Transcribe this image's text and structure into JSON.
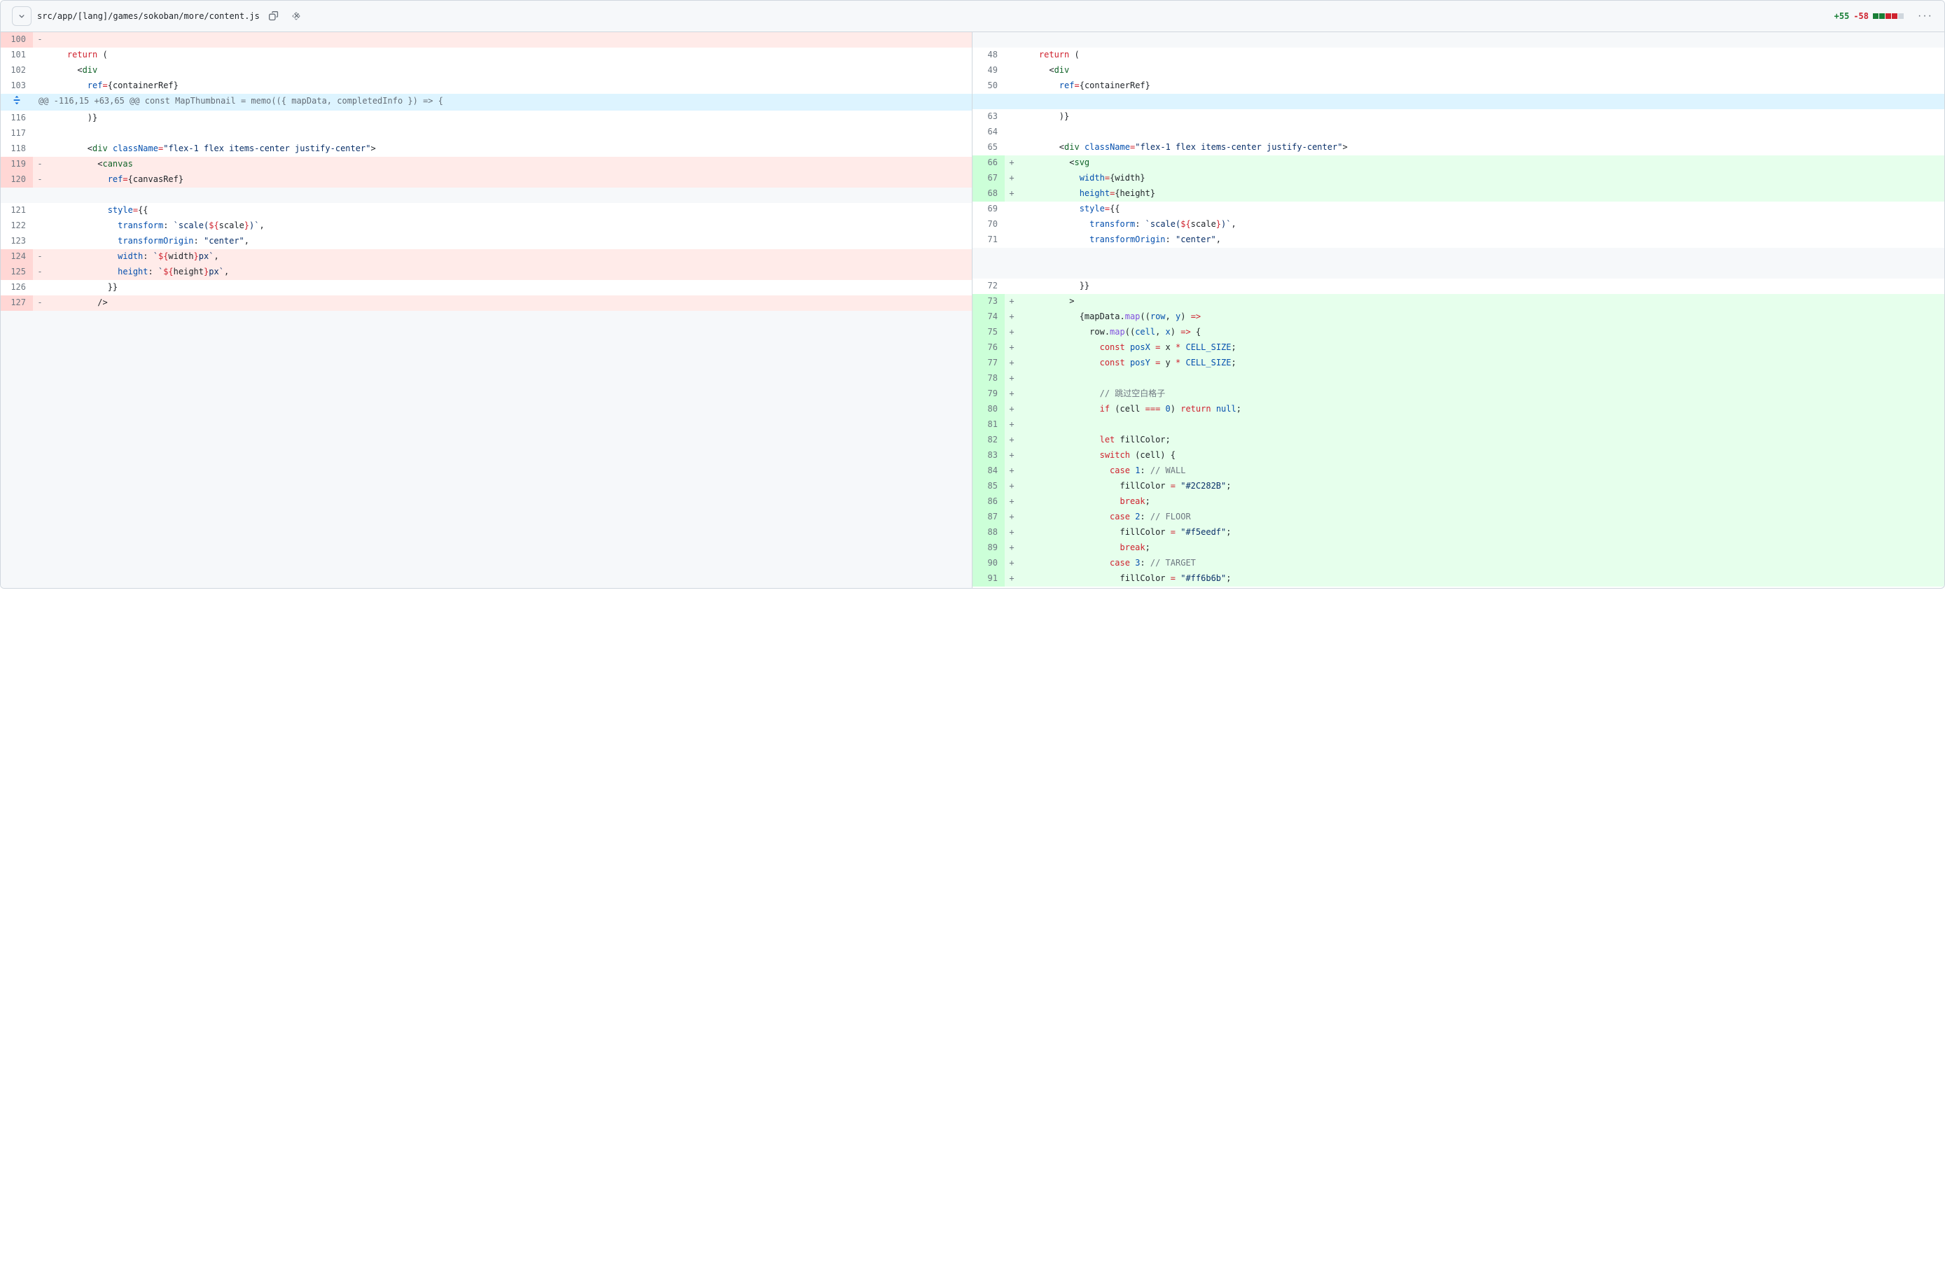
{
  "header": {
    "file_path": "src/app/[lang]/games/sokoban/more/content.js",
    "additions": "+55",
    "deletions": "-58"
  },
  "hunk_header": "@@ -116,15 +63,65 @@ const MapThumbnail = memo(({ mapData, completedInfo }) => {",
  "left_lines": [
    {
      "no": "100",
      "type": "del",
      "marker": "-",
      "tokens": []
    },
    {
      "no": "101",
      "type": "ctx",
      "marker": "",
      "tokens": [
        {
          "c": "    ",
          "cls": ""
        },
        {
          "c": "return",
          "cls": "t-keyword"
        },
        {
          "c": " (",
          "cls": ""
        }
      ]
    },
    {
      "no": "102",
      "type": "ctx",
      "marker": "",
      "tokens": [
        {
          "c": "      <",
          "cls": ""
        },
        {
          "c": "div",
          "cls": "t-tag"
        }
      ]
    },
    {
      "no": "103",
      "type": "ctx",
      "marker": "",
      "tokens": [
        {
          "c": "        ",
          "cls": ""
        },
        {
          "c": "ref",
          "cls": "t-attr"
        },
        {
          "c": "=",
          "cls": "t-op"
        },
        {
          "c": "{containerRef}",
          "cls": ""
        }
      ]
    }
  ],
  "left_lines_2": [
    {
      "no": "116",
      "type": "ctx",
      "marker": "",
      "tokens": [
        {
          "c": "        )}",
          "cls": ""
        }
      ]
    },
    {
      "no": "117",
      "type": "ctx",
      "marker": "",
      "tokens": []
    },
    {
      "no": "118",
      "type": "ctx",
      "marker": "",
      "tokens": [
        {
          "c": "        <",
          "cls": ""
        },
        {
          "c": "div",
          "cls": "t-tag"
        },
        {
          "c": " ",
          "cls": ""
        },
        {
          "c": "className",
          "cls": "t-attr"
        },
        {
          "c": "=",
          "cls": "t-op"
        },
        {
          "c": "\"flex-1 flex items-center justify-center\"",
          "cls": "t-string"
        },
        {
          "c": ">",
          "cls": ""
        }
      ]
    },
    {
      "no": "119",
      "type": "del",
      "marker": "-",
      "tokens": [
        {
          "c": "          <",
          "cls": ""
        },
        {
          "c": "canvas",
          "cls": "t-tag"
        }
      ]
    },
    {
      "no": "120",
      "type": "del",
      "marker": "-",
      "tokens": [
        {
          "c": "            ",
          "cls": ""
        },
        {
          "c": "ref",
          "cls": "t-attr"
        },
        {
          "c": "=",
          "cls": "t-op"
        },
        {
          "c": "{canvasRef}",
          "cls": ""
        }
      ]
    },
    {
      "no": "",
      "type": "empty",
      "marker": "",
      "tokens": []
    },
    {
      "no": "121",
      "type": "ctx",
      "marker": "",
      "tokens": [
        {
          "c": "            ",
          "cls": ""
        },
        {
          "c": "style",
          "cls": "t-attr"
        },
        {
          "c": "=",
          "cls": "t-op"
        },
        {
          "c": "{{",
          "cls": ""
        }
      ]
    },
    {
      "no": "122",
      "type": "ctx",
      "marker": "",
      "tokens": [
        {
          "c": "              ",
          "cls": ""
        },
        {
          "c": "transform",
          "cls": "t-prop"
        },
        {
          "c": ": ",
          "cls": ""
        },
        {
          "c": "`scale(",
          "cls": "t-string"
        },
        {
          "c": "${",
          "cls": "t-op"
        },
        {
          "c": "scale",
          "cls": ""
        },
        {
          "c": "}",
          "cls": "t-op"
        },
        {
          "c": ")`",
          "cls": "t-string"
        },
        {
          "c": ",",
          "cls": ""
        }
      ]
    },
    {
      "no": "123",
      "type": "ctx",
      "marker": "",
      "tokens": [
        {
          "c": "              ",
          "cls": ""
        },
        {
          "c": "transformOrigin",
          "cls": "t-prop"
        },
        {
          "c": ": ",
          "cls": ""
        },
        {
          "c": "\"center\"",
          "cls": "t-string"
        },
        {
          "c": ",",
          "cls": ""
        }
      ]
    },
    {
      "no": "124",
      "type": "del",
      "marker": "-",
      "tokens": [
        {
          "c": "              ",
          "cls": ""
        },
        {
          "c": "width",
          "cls": "t-prop"
        },
        {
          "c": ": ",
          "cls": ""
        },
        {
          "c": "`",
          "cls": "t-string"
        },
        {
          "c": "${",
          "cls": "t-op"
        },
        {
          "c": "width",
          "cls": ""
        },
        {
          "c": "}",
          "cls": "t-op"
        },
        {
          "c": "px`",
          "cls": "t-string"
        },
        {
          "c": ",",
          "cls": ""
        }
      ]
    },
    {
      "no": "125",
      "type": "del",
      "marker": "-",
      "tokens": [
        {
          "c": "              ",
          "cls": ""
        },
        {
          "c": "height",
          "cls": "t-prop"
        },
        {
          "c": ": ",
          "cls": ""
        },
        {
          "c": "`",
          "cls": "t-string"
        },
        {
          "c": "${",
          "cls": "t-op"
        },
        {
          "c": "height",
          "cls": ""
        },
        {
          "c": "}",
          "cls": "t-op"
        },
        {
          "c": "px`",
          "cls": "t-string"
        },
        {
          "c": ",",
          "cls": ""
        }
      ]
    },
    {
      "no": "126",
      "type": "ctx",
      "marker": "",
      "tokens": [
        {
          "c": "            }}",
          "cls": ""
        }
      ]
    },
    {
      "no": "127",
      "type": "del",
      "marker": "-",
      "tokens": [
        {
          "c": "          />",
          "cls": ""
        }
      ]
    }
  ],
  "right_lines": [
    {
      "no": "",
      "type": "empty",
      "marker": "",
      "tokens": []
    },
    {
      "no": "48",
      "type": "ctx",
      "marker": "",
      "tokens": [
        {
          "c": "    ",
          "cls": ""
        },
        {
          "c": "return",
          "cls": "t-keyword"
        },
        {
          "c": " (",
          "cls": ""
        }
      ]
    },
    {
      "no": "49",
      "type": "ctx",
      "marker": "",
      "tokens": [
        {
          "c": "      <",
          "cls": ""
        },
        {
          "c": "div",
          "cls": "t-tag"
        }
      ]
    },
    {
      "no": "50",
      "type": "ctx",
      "marker": "",
      "tokens": [
        {
          "c": "        ",
          "cls": ""
        },
        {
          "c": "ref",
          "cls": "t-attr"
        },
        {
          "c": "=",
          "cls": "t-op"
        },
        {
          "c": "{containerRef}",
          "cls": ""
        }
      ]
    }
  ],
  "right_lines_2": [
    {
      "no": "63",
      "type": "ctx",
      "marker": "",
      "tokens": [
        {
          "c": "        )}",
          "cls": ""
        }
      ]
    },
    {
      "no": "64",
      "type": "ctx",
      "marker": "",
      "tokens": []
    },
    {
      "no": "65",
      "type": "ctx",
      "marker": "",
      "tokens": [
        {
          "c": "        <",
          "cls": ""
        },
        {
          "c": "div",
          "cls": "t-tag"
        },
        {
          "c": " ",
          "cls": ""
        },
        {
          "c": "className",
          "cls": "t-attr"
        },
        {
          "c": "=",
          "cls": "t-op"
        },
        {
          "c": "\"flex-1 flex items-center justify-center\"",
          "cls": "t-string"
        },
        {
          "c": ">",
          "cls": ""
        }
      ]
    },
    {
      "no": "66",
      "type": "add",
      "marker": "+",
      "tokens": [
        {
          "c": "          <",
          "cls": ""
        },
        {
          "c": "svg",
          "cls": "t-tag"
        }
      ]
    },
    {
      "no": "67",
      "type": "add",
      "marker": "+",
      "tokens": [
        {
          "c": "            ",
          "cls": ""
        },
        {
          "c": "width",
          "cls": "t-attr"
        },
        {
          "c": "=",
          "cls": "t-op"
        },
        {
          "c": "{width}",
          "cls": ""
        }
      ]
    },
    {
      "no": "68",
      "type": "add",
      "marker": "+",
      "tokens": [
        {
          "c": "            ",
          "cls": ""
        },
        {
          "c": "height",
          "cls": "t-attr"
        },
        {
          "c": "=",
          "cls": "t-op"
        },
        {
          "c": "{height}",
          "cls": ""
        }
      ]
    },
    {
      "no": "69",
      "type": "ctx",
      "marker": "",
      "tokens": [
        {
          "c": "            ",
          "cls": ""
        },
        {
          "c": "style",
          "cls": "t-attr"
        },
        {
          "c": "=",
          "cls": "t-op"
        },
        {
          "c": "{{",
          "cls": ""
        }
      ]
    },
    {
      "no": "70",
      "type": "ctx",
      "marker": "",
      "tokens": [
        {
          "c": "              ",
          "cls": ""
        },
        {
          "c": "transform",
          "cls": "t-prop"
        },
        {
          "c": ": ",
          "cls": ""
        },
        {
          "c": "`scale(",
          "cls": "t-string"
        },
        {
          "c": "${",
          "cls": "t-op"
        },
        {
          "c": "scale",
          "cls": ""
        },
        {
          "c": "}",
          "cls": "t-op"
        },
        {
          "c": ")`",
          "cls": "t-string"
        },
        {
          "c": ",",
          "cls": ""
        }
      ]
    },
    {
      "no": "71",
      "type": "ctx",
      "marker": "",
      "tokens": [
        {
          "c": "              ",
          "cls": ""
        },
        {
          "c": "transformOrigin",
          "cls": "t-prop"
        },
        {
          "c": ": ",
          "cls": ""
        },
        {
          "c": "\"center\"",
          "cls": "t-string"
        },
        {
          "c": ",",
          "cls": ""
        }
      ]
    },
    {
      "no": "",
      "type": "empty",
      "marker": "",
      "tokens": []
    },
    {
      "no": "",
      "type": "empty",
      "marker": "",
      "tokens": []
    },
    {
      "no": "72",
      "type": "ctx",
      "marker": "",
      "tokens": [
        {
          "c": "            }}",
          "cls": ""
        }
      ]
    },
    {
      "no": "73",
      "type": "add",
      "marker": "+",
      "tokens": [
        {
          "c": "          >",
          "cls": ""
        }
      ]
    },
    {
      "no": "74",
      "type": "add",
      "marker": "+",
      "tokens": [
        {
          "c": "            {mapData.",
          "cls": ""
        },
        {
          "c": "map",
          "cls": "t-func"
        },
        {
          "c": "((",
          "cls": ""
        },
        {
          "c": "row",
          "cls": "t-attr"
        },
        {
          "c": ", ",
          "cls": ""
        },
        {
          "c": "y",
          "cls": "t-attr"
        },
        {
          "c": ") ",
          "cls": ""
        },
        {
          "c": "=>",
          "cls": "t-op"
        }
      ]
    },
    {
      "no": "75",
      "type": "add",
      "marker": "+",
      "tokens": [
        {
          "c": "              row.",
          "cls": ""
        },
        {
          "c": "map",
          "cls": "t-func"
        },
        {
          "c": "((",
          "cls": ""
        },
        {
          "c": "cell",
          "cls": "t-attr"
        },
        {
          "c": ", ",
          "cls": ""
        },
        {
          "c": "x",
          "cls": "t-attr"
        },
        {
          "c": ") ",
          "cls": ""
        },
        {
          "c": "=>",
          "cls": "t-op"
        },
        {
          "c": " {",
          "cls": ""
        }
      ]
    },
    {
      "no": "76",
      "type": "add",
      "marker": "+",
      "tokens": [
        {
          "c": "                ",
          "cls": ""
        },
        {
          "c": "const",
          "cls": "t-keyword"
        },
        {
          "c": " ",
          "cls": ""
        },
        {
          "c": "posX",
          "cls": "t-attr"
        },
        {
          "c": " ",
          "cls": ""
        },
        {
          "c": "=",
          "cls": "t-op"
        },
        {
          "c": " x ",
          "cls": ""
        },
        {
          "c": "*",
          "cls": "t-op"
        },
        {
          "c": " ",
          "cls": ""
        },
        {
          "c": "CELL_SIZE",
          "cls": "t-attr"
        },
        {
          "c": ";",
          "cls": ""
        }
      ]
    },
    {
      "no": "77",
      "type": "add",
      "marker": "+",
      "tokens": [
        {
          "c": "                ",
          "cls": ""
        },
        {
          "c": "const",
          "cls": "t-keyword"
        },
        {
          "c": " ",
          "cls": ""
        },
        {
          "c": "posY",
          "cls": "t-attr"
        },
        {
          "c": " ",
          "cls": ""
        },
        {
          "c": "=",
          "cls": "t-op"
        },
        {
          "c": " y ",
          "cls": ""
        },
        {
          "c": "*",
          "cls": "t-op"
        },
        {
          "c": " ",
          "cls": ""
        },
        {
          "c": "CELL_SIZE",
          "cls": "t-attr"
        },
        {
          "c": ";",
          "cls": ""
        }
      ]
    },
    {
      "no": "78",
      "type": "add",
      "marker": "+",
      "tokens": []
    },
    {
      "no": "79",
      "type": "add",
      "marker": "+",
      "tokens": [
        {
          "c": "                ",
          "cls": ""
        },
        {
          "c": "// 跳过空白格子",
          "cls": "t-comment"
        }
      ]
    },
    {
      "no": "80",
      "type": "add",
      "marker": "+",
      "tokens": [
        {
          "c": "                ",
          "cls": ""
        },
        {
          "c": "if",
          "cls": "t-keyword"
        },
        {
          "c": " (cell ",
          "cls": ""
        },
        {
          "c": "===",
          "cls": "t-op"
        },
        {
          "c": " ",
          "cls": ""
        },
        {
          "c": "0",
          "cls": "t-num"
        },
        {
          "c": ") ",
          "cls": ""
        },
        {
          "c": "return",
          "cls": "t-keyword"
        },
        {
          "c": " ",
          "cls": ""
        },
        {
          "c": "null",
          "cls": "t-num"
        },
        {
          "c": ";",
          "cls": ""
        }
      ]
    },
    {
      "no": "81",
      "type": "add",
      "marker": "+",
      "tokens": []
    },
    {
      "no": "82",
      "type": "add",
      "marker": "+",
      "tokens": [
        {
          "c": "                ",
          "cls": ""
        },
        {
          "c": "let",
          "cls": "t-keyword"
        },
        {
          "c": " fillColor;",
          "cls": ""
        }
      ]
    },
    {
      "no": "83",
      "type": "add",
      "marker": "+",
      "tokens": [
        {
          "c": "                ",
          "cls": ""
        },
        {
          "c": "switch",
          "cls": "t-keyword"
        },
        {
          "c": " (cell) {",
          "cls": ""
        }
      ]
    },
    {
      "no": "84",
      "type": "add",
      "marker": "+",
      "tokens": [
        {
          "c": "                  ",
          "cls": ""
        },
        {
          "c": "case",
          "cls": "t-keyword"
        },
        {
          "c": " ",
          "cls": ""
        },
        {
          "c": "1",
          "cls": "t-num"
        },
        {
          "c": ": ",
          "cls": ""
        },
        {
          "c": "// WALL",
          "cls": "t-comment"
        }
      ]
    },
    {
      "no": "85",
      "type": "add",
      "marker": "+",
      "tokens": [
        {
          "c": "                    fillColor ",
          "cls": ""
        },
        {
          "c": "=",
          "cls": "t-op"
        },
        {
          "c": " ",
          "cls": ""
        },
        {
          "c": "\"#2C282B\"",
          "cls": "t-string"
        },
        {
          "c": ";",
          "cls": ""
        }
      ]
    },
    {
      "no": "86",
      "type": "add",
      "marker": "+",
      "tokens": [
        {
          "c": "                    ",
          "cls": ""
        },
        {
          "c": "break",
          "cls": "t-keyword"
        },
        {
          "c": ";",
          "cls": ""
        }
      ]
    },
    {
      "no": "87",
      "type": "add",
      "marker": "+",
      "tokens": [
        {
          "c": "                  ",
          "cls": ""
        },
        {
          "c": "case",
          "cls": "t-keyword"
        },
        {
          "c": " ",
          "cls": ""
        },
        {
          "c": "2",
          "cls": "t-num"
        },
        {
          "c": ": ",
          "cls": ""
        },
        {
          "c": "// FLOOR",
          "cls": "t-comment"
        }
      ]
    },
    {
      "no": "88",
      "type": "add",
      "marker": "+",
      "tokens": [
        {
          "c": "                    fillColor ",
          "cls": ""
        },
        {
          "c": "=",
          "cls": "t-op"
        },
        {
          "c": " ",
          "cls": ""
        },
        {
          "c": "\"#f5eedf\"",
          "cls": "t-string"
        },
        {
          "c": ";",
          "cls": ""
        }
      ]
    },
    {
      "no": "89",
      "type": "add",
      "marker": "+",
      "tokens": [
        {
          "c": "                    ",
          "cls": ""
        },
        {
          "c": "break",
          "cls": "t-keyword"
        },
        {
          "c": ";",
          "cls": ""
        }
      ]
    },
    {
      "no": "90",
      "type": "add",
      "marker": "+",
      "tokens": [
        {
          "c": "                  ",
          "cls": ""
        },
        {
          "c": "case",
          "cls": "t-keyword"
        },
        {
          "c": " ",
          "cls": ""
        },
        {
          "c": "3",
          "cls": "t-num"
        },
        {
          "c": ": ",
          "cls": ""
        },
        {
          "c": "// TARGET",
          "cls": "t-comment"
        }
      ]
    },
    {
      "no": "91",
      "type": "add",
      "marker": "+",
      "tokens": [
        {
          "c": "                    fillColor ",
          "cls": ""
        },
        {
          "c": "=",
          "cls": "t-op"
        },
        {
          "c": " ",
          "cls": ""
        },
        {
          "c": "\"#ff6b6b\"",
          "cls": "t-string"
        },
        {
          "c": ";",
          "cls": ""
        }
      ]
    }
  ]
}
